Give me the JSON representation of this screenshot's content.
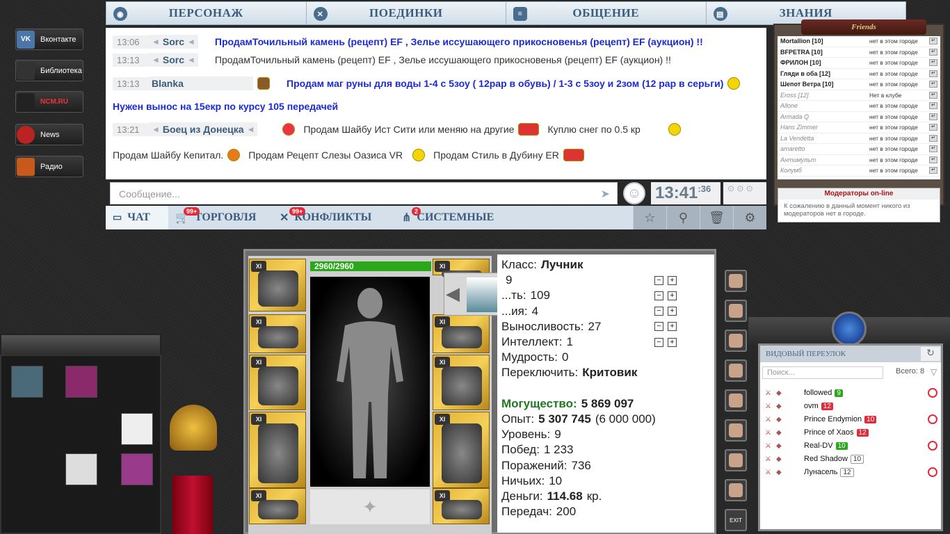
{
  "left_links": [
    {
      "label": "Вконтакте",
      "icon": "vk-icon",
      "badge": "VK"
    },
    {
      "label": "Библиотека",
      "icon": "library-icon",
      "badge": ""
    },
    {
      "label": "",
      "icon": "ncm-logo-icon",
      "badge": "NCM.RU"
    },
    {
      "label": "News",
      "icon": "news-icon",
      "badge": ""
    },
    {
      "label": "Радио",
      "icon": "radio-icon",
      "badge": ""
    }
  ],
  "nav": {
    "tabs": [
      "ПЕРСОНАЖ",
      "ПОЕДИНКИ",
      "ОБЩЕНИЕ",
      "ЗНАНИЯ"
    ]
  },
  "chat": {
    "messages": [
      {
        "time": "13:06",
        "nick": "Sorc",
        "text": "ПродамТочильный камень (рецепт) EF , Зелье иссушающего прикосновенья (рецепт) EF (аукцион) !!",
        "style": "blue"
      },
      {
        "time": "13:13",
        "nick": "Sorc",
        "text": "ПродамТочильный камень (рецепт) EF , Зелье иссушающего прикосновенья (рецепт) EF (аукцион) !!",
        "style": "normal"
      },
      {
        "time": "13:13",
        "nick": "Blanka",
        "text": "Продам маг руны для воды 1-4 с 5зоу ( 12рар в обувь) / 1-3 с 5зоу и 2зом (12 рар в серьги)",
        "style": "blue"
      },
      {
        "time": "",
        "nick": "",
        "text": "Нужен вынос на 15екр по курсу 105 передачей",
        "style": "blue"
      },
      {
        "time": "13:21",
        "nick": "Боец из Донецка",
        "text": "Продам Шайбу Ист Сити или меняю на другие",
        "style": "normal"
      },
      {
        "time": "",
        "nick": "",
        "text": "Продам Шайбу Кепитал.",
        "style": "normal"
      }
    ],
    "extra": [
      "Куплю снег по 0.5 кр",
      "Продам Рецепт Слезы Оазиса VR",
      "Продам Стиль в Дубину ER"
    ],
    "input_placeholder": "Сообщение...",
    "clock": "13:41",
    "clock_sec": ":36"
  },
  "chat_tabs": [
    {
      "label": "ЧАТ",
      "badge": ""
    },
    {
      "label": "ТОРГОВЛЯ",
      "badge": "99+"
    },
    {
      "label": "КОНФЛИКТЫ",
      "badge": "99+"
    },
    {
      "label": "СИСТЕМНЫЕ",
      "badge": "2"
    }
  ],
  "friends": {
    "title": "Friends",
    "list": [
      {
        "name": "Mortallion",
        "lvl": "[10]",
        "status": "нет в этом городе",
        "online": true
      },
      {
        "name": "BFPETRA",
        "lvl": "[10]",
        "status": "нет в этом городе",
        "online": true
      },
      {
        "name": "ФРИЛОН",
        "lvl": "[10]",
        "status": "нет в этом городе",
        "online": true
      },
      {
        "name": "Гляди в оба",
        "lvl": "[12]",
        "status": "нет в этом городе",
        "online": true
      },
      {
        "name": "Шепот Ветра",
        "lvl": "[10]",
        "status": "нет в этом городе",
        "online": true
      },
      {
        "name": "Eross",
        "lvl": "[12]",
        "status": "Нет в клубе",
        "online": false
      },
      {
        "name": "Allone",
        "lvl": "",
        "status": "нет в этом городе",
        "online": false
      },
      {
        "name": "Armada Q",
        "lvl": "",
        "status": "нет в этом городе",
        "online": false
      },
      {
        "name": "Hans Zimmer",
        "lvl": "",
        "status": "нет в этом городе",
        "online": false
      },
      {
        "name": "La Vendetta",
        "lvl": "",
        "status": "нет в этом городе",
        "online": false
      },
      {
        "name": "amaretto",
        "lvl": "",
        "status": "нет в этом городе",
        "online": false
      },
      {
        "name": "Антимульт",
        "lvl": "",
        "status": "нет в этом городе",
        "online": false
      },
      {
        "name": "Колумб",
        "lvl": "",
        "status": "нет в этом городе",
        "online": false
      }
    ],
    "mods_title": "Модераторы on-line",
    "mods_text": "К сожалению в данный момент никого из модераторов нет в городе."
  },
  "character": {
    "hp": "2960/2960",
    "stats": [
      {
        "label": "Класс:",
        "value": "Лучник",
        "bold": true,
        "pm": false
      },
      {
        "label": "",
        "value": "9",
        "bold": false,
        "pm": true
      },
      {
        "label": "...ть:",
        "value": "109",
        "bold": false,
        "pm": true
      },
      {
        "label": "...ия:",
        "value": "4",
        "bold": false,
        "pm": true
      },
      {
        "label": "Выносливость:",
        "value": "27",
        "bold": false,
        "pm": true
      },
      {
        "label": "Интеллект:",
        "value": "1",
        "bold": false,
        "pm": true
      },
      {
        "label": "Мудрость:",
        "value": "0",
        "bold": false,
        "pm": false
      },
      {
        "label": "Переключить:",
        "value": "Критовик",
        "bold": true,
        "pm": false
      },
      {
        "label": "",
        "value": "",
        "bold": false,
        "pm": false
      },
      {
        "label": "Могущество:",
        "value": "5 869 097",
        "bold": true,
        "pm": false
      },
      {
        "label": "Опыт:",
        "value": "5 307 745",
        "bold": true,
        "pm": false
      },
      {
        "label": "Уровень:",
        "value": "9",
        "bold": false,
        "pm": false
      },
      {
        "label": "Побед:",
        "value": "1 233",
        "bold": false,
        "pm": false
      },
      {
        "label": "Поражений:",
        "value": "736",
        "bold": false,
        "pm": false
      },
      {
        "label": "Ничьих:",
        "value": "10",
        "bold": false,
        "pm": false
      },
      {
        "label": "Деньги:",
        "value": "114.68",
        "bold": true,
        "pm": false
      },
      {
        "label": "Передач:",
        "value": "200",
        "bold": false,
        "pm": false
      }
    ],
    "exp_next": "(6 000 000)",
    "money_unit": "кр.",
    "slot_badge": "XI"
  },
  "location": {
    "title": "ВИДОВЫЙ ПЕРЕУЛОК",
    "search_placeholder": "Поиск...",
    "total": "Всего: 8",
    "users": [
      {
        "name": "followed",
        "lvl": "9",
        "lvl_color": "g",
        "target": true
      },
      {
        "name": "ovm",
        "lvl": "12",
        "lvl_color": "r",
        "target": false
      },
      {
        "name": "Prince Endymion",
        "lvl": "10",
        "lvl_color": "r",
        "target": true
      },
      {
        "name": "Prince of Xaos",
        "lvl": "12",
        "lvl_color": "r",
        "target": false
      },
      {
        "name": "Real-DV",
        "lvl": "10",
        "lvl_color": "g",
        "target": true
      },
      {
        "name": "Red Shadow",
        "lvl": "10",
        "lvl_color": "w",
        "target": false
      },
      {
        "name": "Лунасель",
        "lvl": "12",
        "lvl_color": "w",
        "target": true
      }
    ]
  },
  "colors": {
    "accent": "#3b5c7c",
    "gold": "#e2b233",
    "hp": "#2aa81a",
    "alert": "#e02b3b"
  }
}
